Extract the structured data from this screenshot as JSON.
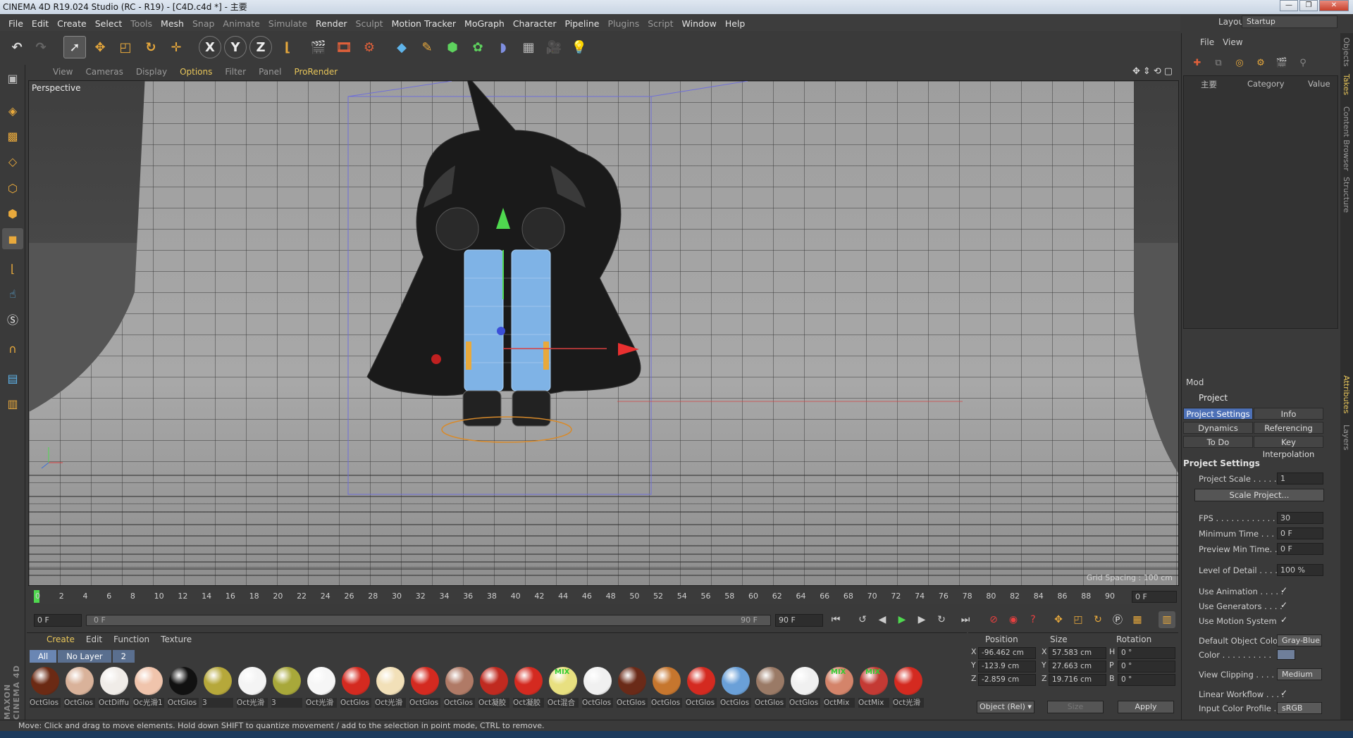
{
  "window": {
    "title": "CINEMA 4D R19.024 Studio (RC - R19) - [C4D.c4d *] - 主要",
    "minimize": "—",
    "maximize": "❐",
    "close": "✕"
  },
  "menubar": {
    "items": [
      "File",
      "Edit",
      "Create",
      "Select",
      "Tools",
      "Mesh",
      "Snap",
      "Animate",
      "Simulate",
      "Render",
      "Sculpt",
      "Motion Tracker",
      "MoGraph",
      "Character",
      "Pipeline",
      "Plugins",
      "Script",
      "Window",
      "Help"
    ],
    "dim_items": [
      "Tools",
      "Snap",
      "Animate",
      "Simulate",
      "Sculpt",
      "Plugins",
      "Script"
    ],
    "layout_label": "Layout:",
    "layout_value": "Startup"
  },
  "toolbar": {
    "axis_x": "X",
    "axis_y": "Y",
    "axis_z": "Z"
  },
  "viewport": {
    "menu": [
      "View",
      "Cameras",
      "Display",
      "Options",
      "Filter",
      "Panel",
      "ProRender"
    ],
    "highlighted": [
      "Options",
      "ProRender"
    ],
    "camera_label": "Perspective",
    "grid_spacing": "Grid Spacing : 100 cm"
  },
  "timeline": {
    "ticks": [
      "0",
      "2",
      "4",
      "6",
      "8",
      "10",
      "12",
      "14",
      "16",
      "18",
      "20",
      "22",
      "24",
      "26",
      "28",
      "30",
      "32",
      "34",
      "36",
      "38",
      "40",
      "42",
      "44",
      "46",
      "48",
      "50",
      "52",
      "54",
      "56",
      "58",
      "60",
      "62",
      "64",
      "66",
      "68",
      "70",
      "72",
      "74",
      "76",
      "78",
      "80",
      "82",
      "84",
      "86",
      "88",
      "90"
    ],
    "current_frame": "0 F"
  },
  "transport": {
    "start_field": "0 F",
    "slider_start": "0 F",
    "slider_end": "90 F",
    "end_field": "90 F"
  },
  "material_manager": {
    "menu": [
      "Create",
      "Edit",
      "Function",
      "Texture"
    ],
    "layers": [
      "All",
      "No Layer",
      "2"
    ],
    "materials": [
      {
        "label": "OctGlos",
        "color": "#6b2a14"
      },
      {
        "label": "OctGlos",
        "color": "#d9b29a"
      },
      {
        "label": "OctDiffu",
        "color": "#f0ece8"
      },
      {
        "label": "Oc光滑1",
        "color": "#f0c4ac"
      },
      {
        "label": "OctGlos",
        "color": "#111111"
      },
      {
        "label": "3",
        "color": "#b6a83a"
      },
      {
        "label": "Oct光滑",
        "color": "#f4f4f4"
      },
      {
        "label": "3",
        "color": "#a8a83a"
      },
      {
        "label": "Oct光滑",
        "color": "#f6f6f6"
      },
      {
        "label": "OctGlos",
        "color": "#d42a20"
      },
      {
        "label": "Oct光滑",
        "color": "#f2e0b8"
      },
      {
        "label": "OctGlos",
        "color": "#d42a20"
      },
      {
        "label": "OctGlos",
        "color": "#b07a66"
      },
      {
        "label": "Oct凝胶",
        "color": "#c02a20"
      },
      {
        "label": "Oct凝胶",
        "color": "#d42a20"
      },
      {
        "label": "Oct混合",
        "color": "#e8e080",
        "mix": "MIX"
      },
      {
        "label": "OctGlos",
        "color": "#f0f0f0"
      },
      {
        "label": "OctGlos",
        "color": "#6a2a18"
      },
      {
        "label": "OctGlos",
        "color": "#c6762e"
      },
      {
        "label": "OctGlos",
        "color": "#d42a20"
      },
      {
        "label": "OctGlos",
        "color": "#6aa0d8"
      },
      {
        "label": "OctGlos",
        "color": "#9a7a66"
      },
      {
        "label": "OctGlos",
        "color": "#f0f0f0"
      },
      {
        "label": "OctMix",
        "color": "#d4846a",
        "mix": "MIX"
      },
      {
        "label": "OctMix",
        "color": "#c43a34",
        "mix": "MIX"
      },
      {
        "label": "Oct光滑",
        "color": "#d42a20"
      }
    ]
  },
  "coordinates": {
    "headers": {
      "position": "Position",
      "size": "Size",
      "rotation": "Rotation"
    },
    "rows": [
      {
        "axis": "X",
        "pos": "-96.462 cm",
        "size_axis": "X",
        "size": "57.583 cm",
        "rot_axis": "H",
        "rot": "0 °"
      },
      {
        "axis": "Y",
        "pos": "-123.9 cm",
        "size_axis": "Y",
        "size": "27.663 cm",
        "rot_axis": "P",
        "rot": "0 °"
      },
      {
        "axis": "Z",
        "pos": "-2.859 cm",
        "size_axis": "Z",
        "size": "19.716 cm",
        "rot_axis": "B",
        "rot": "0 °"
      }
    ],
    "mode_select": "Object (Rel) ▾",
    "size_select": "Size",
    "apply": "Apply"
  },
  "statusbar": {
    "text": "Move: Click and drag to move elements. Hold down SHIFT to quantize movement / add to the selection in point mode, CTRL to remove."
  },
  "object_manager": {
    "menu": [
      "File",
      "View"
    ],
    "col_name": "主要",
    "col_category": "Category",
    "col_value": "Value"
  },
  "attributes": {
    "mode": "Mod",
    "object": "Project",
    "tabs": [
      "Project Settings",
      "Info",
      "Dynamics",
      "Referencing",
      "To Do",
      "Key Interpolation"
    ],
    "active_tab": "Project Settings",
    "section": "Project Settings",
    "project_scale_label": "Project Scale . . . . . .",
    "project_scale": "1",
    "scale_project_button": "Scale Project...",
    "fps_label": "FPS . . . . . . . . . . . . .",
    "fps": "30",
    "min_time_label": "Minimum Time . . . . .",
    "min_time": "0 F",
    "preview_min_label": "Preview Min Time. . .",
    "preview_min": "0 F",
    "lod_label": "Level of Detail . . . . .",
    "lod": "100 %",
    "use_animation_label": "Use Animation . . . . .",
    "use_generators_label": "Use Generators . . . .",
    "use_motion_label": "Use Motion System",
    "default_color_label": "Default Object Color",
    "default_color": "Gray-Blue",
    "color_label": "Color . . . . . . . . . .",
    "view_clipping_label": "View Clipping . . . . .",
    "view_clipping": "Medium",
    "linear_workflow_label": "Linear Workflow . . . .",
    "input_color_label": "Input Color Profile . .",
    "input_color": "sRGB",
    "check": "✓"
  },
  "side_tabs": [
    "Objects",
    "Takes",
    "Content Browser",
    "Structure",
    "Attributes",
    "Layers"
  ]
}
